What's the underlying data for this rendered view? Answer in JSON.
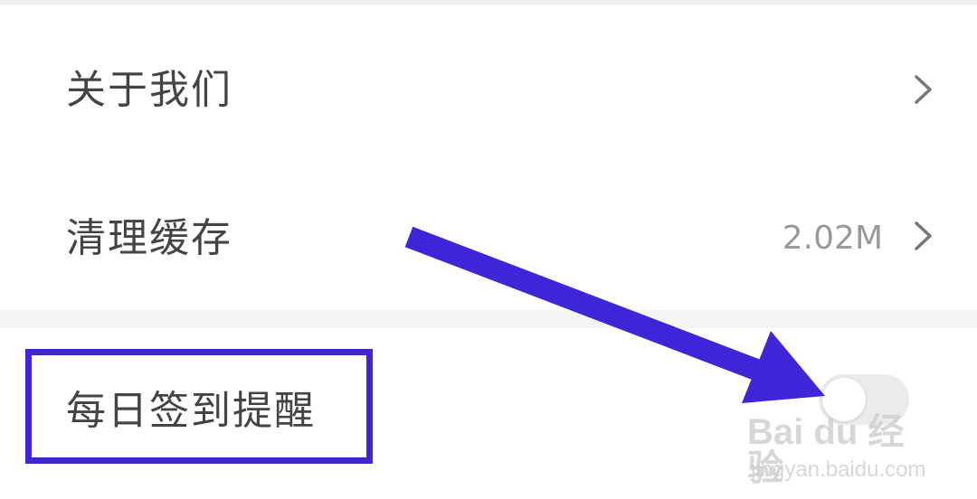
{
  "settings": {
    "items": [
      {
        "label": "关于我们",
        "value": "",
        "has_chevron": true,
        "icon": "chevron-right-icon"
      },
      {
        "label": "清理缓存",
        "value": "2.02M",
        "has_chevron": true,
        "icon": "chevron-right-icon"
      },
      {
        "label": "每日签到提醒",
        "control": "toggle",
        "toggle_on": false
      }
    ]
  },
  "annotation": {
    "arrow_color": "#3f25d8",
    "box_color": "#3f25d8",
    "arrow_icon": "arrow-pointer-icon"
  },
  "watermark": {
    "brand": "Bai du 经验",
    "url": "jingyan.baidu.com"
  }
}
